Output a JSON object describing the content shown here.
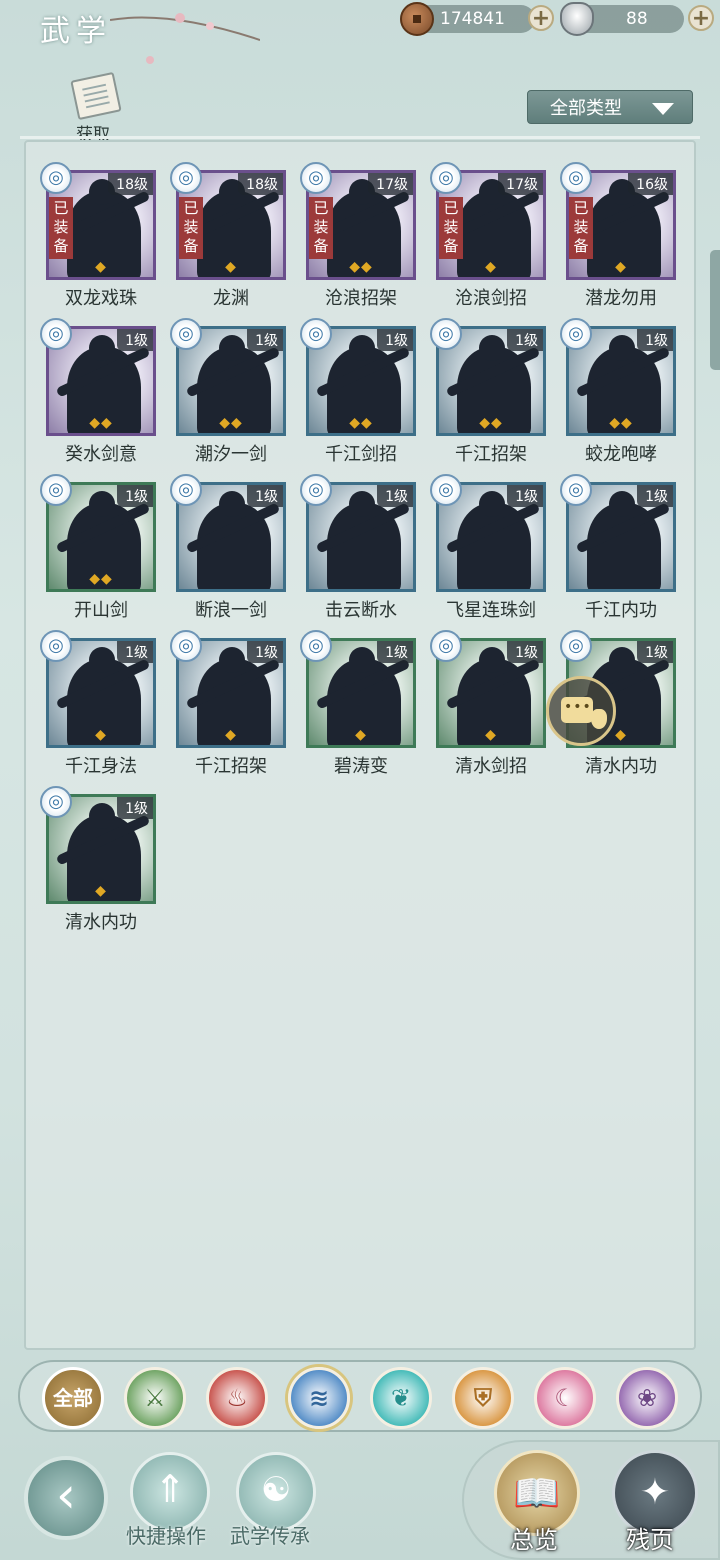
{
  "header": {
    "title": "武学",
    "copper": "174841",
    "silver": "88",
    "add_icon": "plus-icon"
  },
  "toolbar": {
    "acquire_label": "获取",
    "filter_label": "全部类型"
  },
  "skills": [
    {
      "name": "双龙戏珠",
      "level": "18级",
      "equipped": "已装备",
      "rank": "◆",
      "tier": "purple"
    },
    {
      "name": "龙渊",
      "level": "18级",
      "equipped": "已装备",
      "rank": "◆",
      "tier": "purple"
    },
    {
      "name": "沧浪招架",
      "level": "17级",
      "equipped": "已装备",
      "rank": "◆◆",
      "tier": "purple"
    },
    {
      "name": "沧浪剑招",
      "level": "17级",
      "equipped": "已装备",
      "rank": "◆",
      "tier": "purple"
    },
    {
      "name": "潜龙勿用",
      "level": "16级",
      "equipped": "已装备",
      "rank": "◆",
      "tier": "purple"
    },
    {
      "name": "癸水剑意",
      "level": "1级",
      "equipped": "",
      "rank": "◆◆",
      "tier": "purple"
    },
    {
      "name": "潮汐一剑",
      "level": "1级",
      "equipped": "",
      "rank": "◆◆",
      "tier": "blue"
    },
    {
      "name": "千江剑招",
      "level": "1级",
      "equipped": "",
      "rank": "◆◆",
      "tier": "blue"
    },
    {
      "name": "千江招架",
      "level": "1级",
      "equipped": "",
      "rank": "◆◆",
      "tier": "blue"
    },
    {
      "name": "蛟龙咆哮",
      "level": "1级",
      "equipped": "",
      "rank": "◆◆",
      "tier": "blue"
    },
    {
      "name": "开山剑",
      "level": "1级",
      "equipped": "",
      "rank": "◆◆",
      "tier": "green"
    },
    {
      "name": "断浪一剑",
      "level": "1级",
      "equipped": "",
      "rank": "",
      "tier": "blue"
    },
    {
      "name": "击云断水",
      "level": "1级",
      "equipped": "",
      "rank": "",
      "tier": "blue"
    },
    {
      "name": "飞星连珠剑",
      "level": "1级",
      "equipped": "",
      "rank": "",
      "tier": "blue"
    },
    {
      "name": "千江内功",
      "level": "1级",
      "equipped": "",
      "rank": "",
      "tier": "blue"
    },
    {
      "name": "千江身法",
      "level": "1级",
      "equipped": "",
      "rank": "◆",
      "tier": "blue"
    },
    {
      "name": "千江招架",
      "level": "1级",
      "equipped": "",
      "rank": "◆",
      "tier": "blue"
    },
    {
      "name": "碧涛变",
      "level": "1级",
      "equipped": "",
      "rank": "◆",
      "tier": "green"
    },
    {
      "name": "清水剑招",
      "level": "1级",
      "equipped": "",
      "rank": "◆",
      "tier": "green"
    },
    {
      "name": "清水内功",
      "level": "1级",
      "equipped": "",
      "rank": "◆",
      "tier": "green"
    },
    {
      "name": "清水内功",
      "level": "1级",
      "equipped": "",
      "rank": "◆",
      "tier": "green"
    }
  ],
  "categories": [
    {
      "label": "全部",
      "icon": "all-icon",
      "color": "#9a7a3e"
    },
    {
      "label": "",
      "icon": "sword-green-icon",
      "color": "#5f9a52"
    },
    {
      "label": "",
      "icon": "flame-icon",
      "color": "#c2413a"
    },
    {
      "label": "",
      "icon": "wave-icon",
      "color": "#3f7fc0"
    },
    {
      "label": "",
      "icon": "butterfly-icon",
      "color": "#2fb3b0"
    },
    {
      "label": "",
      "icon": "shield-icon",
      "color": "#d58b2e"
    },
    {
      "label": "",
      "icon": "crescent-icon",
      "color": "#d96a95"
    },
    {
      "label": "",
      "icon": "rose-icon",
      "color": "#8a5aa8"
    }
  ],
  "bottom_nav": {
    "quick_label": "快捷操作",
    "inherit_label": "武学传承",
    "overview_label": "总览",
    "fragment_label": "残页"
  }
}
